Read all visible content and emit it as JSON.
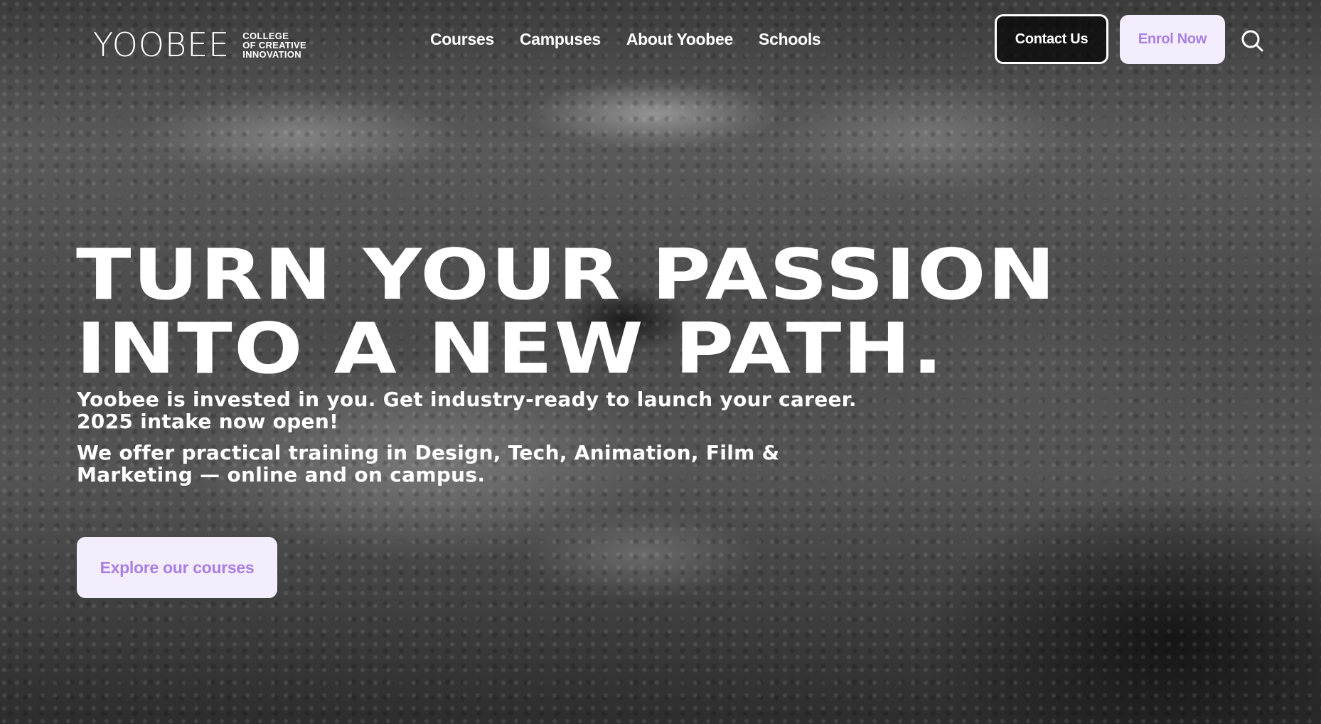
{
  "header": {
    "logo": {
      "wordmark": "YOOBEE",
      "tagline": [
        "COLLEGE",
        "OF CREATIVE",
        "INNOVATION"
      ]
    },
    "nav": [
      "Courses",
      "Campuses",
      "About Yoobee",
      "Schools"
    ],
    "contact_label": "Contact Us",
    "enrol_label": "Enrol Now",
    "search_icon": "search-icon"
  },
  "hero": {
    "headline_line1": "TURN YOUR PASSION",
    "headline_line2": "INTO A NEW PATH.",
    "subtitle_line1": "Yoobee is invested in you. Get industry-ready to launch your career.",
    "subtitle_line2": "2025 intake now open!",
    "description": "We offer practical training in Design, Tech, Animation, Film & Marketing — online and on campus.",
    "cta_label": "Explore our courses"
  },
  "colors": {
    "accent": "#a87fe0",
    "button_bg": "#f4edfe",
    "text": "#ffffff"
  }
}
